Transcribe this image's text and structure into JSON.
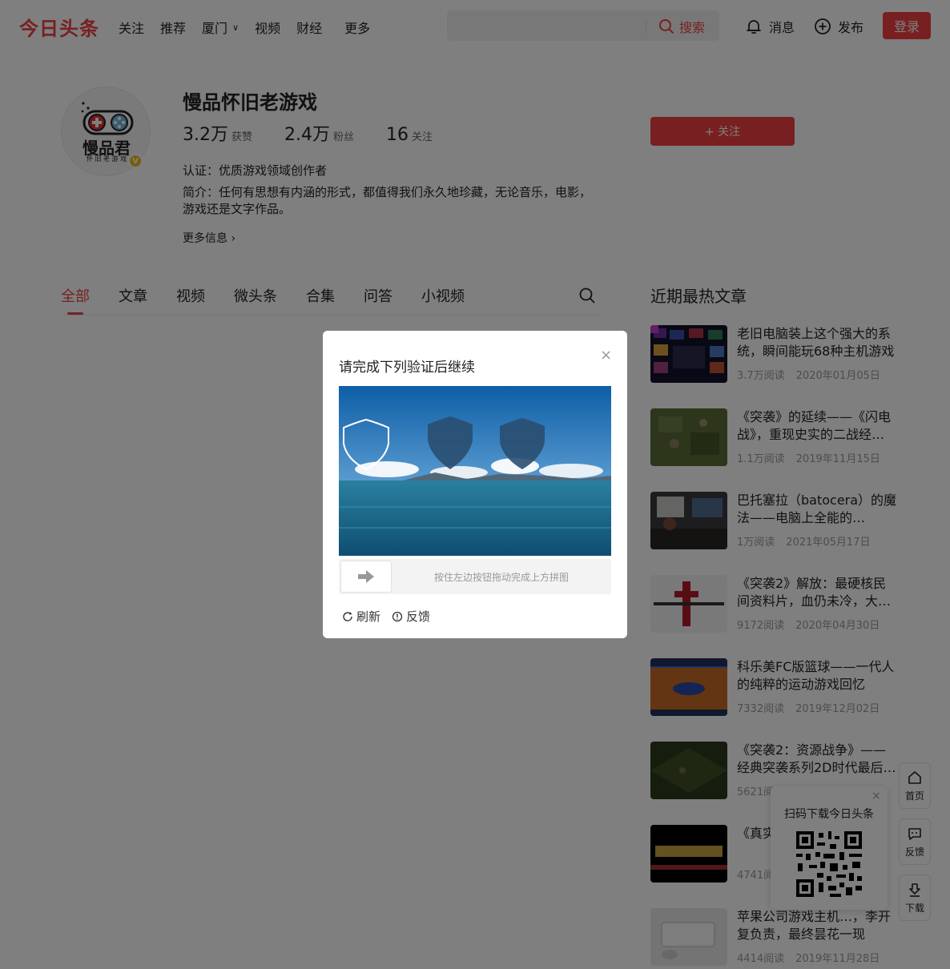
{
  "header": {
    "logo": "今日头条",
    "nav": [
      "关注",
      "推荐",
      "厦门",
      "视频",
      "财经",
      "更多"
    ],
    "search_button": "搜索",
    "messages": "消息",
    "publish": "发布",
    "login": "登录",
    "brand_color": "#f04142"
  },
  "profile": {
    "name": "慢品怀旧老游戏",
    "avatar_text": "慢品君",
    "avatar_subtext": "怀 旧 老 游 戏",
    "verified_badge": "V",
    "stats": [
      {
        "num": "3.2万",
        "label": "获赞"
      },
      {
        "num": "2.4万",
        "label": "粉丝"
      },
      {
        "num": "16",
        "label": "关注"
      }
    ],
    "certification": "认证：优质游戏领域创作者",
    "intro": "简介：任何有思想有内涵的形式，都值得我们永久地珍藏，无论音乐，电影，游戏还是文字作品。",
    "more_info": "更多信息 ›",
    "follow_button": "+ 关注"
  },
  "tabs": {
    "items": [
      "全部",
      "文章",
      "视频",
      "微头条",
      "合集",
      "问答",
      "小视频"
    ],
    "active": "全部"
  },
  "sidebar": {
    "title": "近期最热文章",
    "articles": [
      {
        "title": "老旧电脑装上这个强大的系统，瞬间能玩68种主机游戏",
        "reads": "3.7万阅读",
        "date": "2020年01月05日"
      },
      {
        "title": "《突袭》的延续——《闪电战》，重现史实的二战经…",
        "reads": "1.1万阅读",
        "date": "2019年11月15日"
      },
      {
        "title": "巴托塞拉（batocera）的魔法——电脑上全能的…",
        "reads": "1万阅读",
        "date": "2021年05月17日"
      },
      {
        "title": "《突袭2》解放：最硬核民间资料片，血仍未冷，大…",
        "reads": "9172阅读",
        "date": "2020年04月30日"
      },
      {
        "title": "科乐美FC版篮球——一代人的纯粹的运动游戏回忆",
        "reads": "7332阅读",
        "date": "2019年12月02日"
      },
      {
        "title": "《突袭2：资源战争》——经典突袭系列2D时代最后…",
        "reads": "5621阅读",
        "date": ""
      },
      {
        "title": "《真实…戏中…",
        "reads": "4741阅读",
        "date": ""
      },
      {
        "title": "苹果公司游戏主机…，李开复负责，最终昙花一现",
        "reads": "4414阅读",
        "date": "2019年11月28日"
      }
    ]
  },
  "tools": {
    "home": "首页",
    "feedback": "反馈",
    "download": "下载",
    "qr_text": "扫码下载今日头条",
    "qr_close": "×"
  },
  "modal": {
    "title": "请完成下列验证后继续",
    "close": "×",
    "slider_hint": "按住左边按钮拖动完成上方拼图",
    "refresh": "刷新",
    "feedback": "反馈"
  }
}
